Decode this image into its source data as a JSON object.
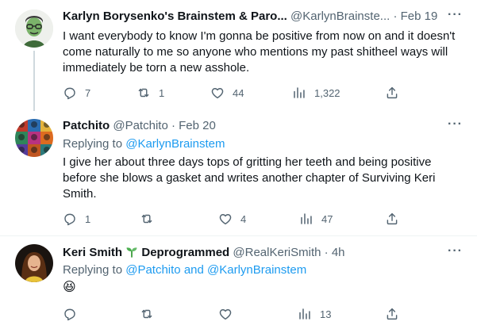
{
  "tweets": [
    {
      "name": "Karlyn Borysenko's Brainstem & Paro...",
      "handle": "@KarlynBrainste...",
      "time": "· Feb 19",
      "text": "I want everybody to know I'm gonna be positive from now on and it doesn't come naturally to me so anyone who mentions my past shitheel ways will immediately be torn a new asshole.",
      "stats": {
        "replies": "7",
        "retweets": "1",
        "likes": "44",
        "views": "1,322"
      }
    },
    {
      "name": "Patchito",
      "handle": "@Patchito",
      "time": "· Feb 20",
      "replying_prefix": "Replying to ",
      "replying_to": "@KarlynBrainstem",
      "text": "I give her about three days tops of gritting her teeth and being positive before she blows a gasket and writes another chapter of Surviving Keri Smith.",
      "stats": {
        "replies": "1",
        "retweets": "",
        "likes": "4",
        "views": "47"
      }
    },
    {
      "name_part1": "Keri Smith",
      "name_part2": "Deprogrammed",
      "handle": "@RealKeriSmith",
      "time": "· 4h",
      "replying_prefix": "Replying to ",
      "replying_to": "@Patchito and @KarlynBrainstem",
      "text": "😆",
      "stats": {
        "replies": "",
        "retweets": "",
        "likes": "",
        "views": "13"
      }
    }
  ],
  "more_label": "···",
  "icons": [
    "reply-icon",
    "retweet-icon",
    "like-icon",
    "views-icon",
    "share-icon",
    "sprout-icon"
  ],
  "colors": {
    "link": "#1d9bf0",
    "muted": "#536471",
    "text": "#0f1419",
    "thread": "#cfd9de"
  }
}
